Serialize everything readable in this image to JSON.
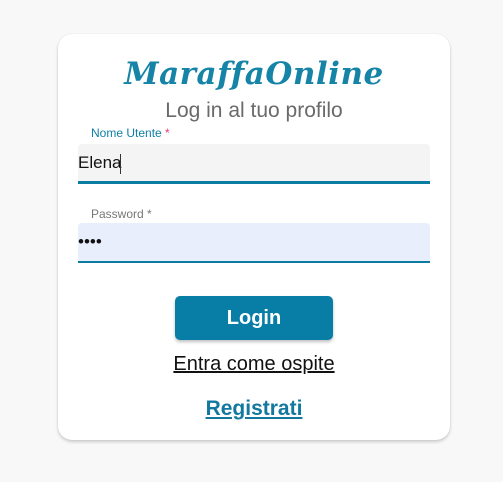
{
  "app": {
    "brand": "MaraffaOnline",
    "subtitle": "Log in al tuo profilo"
  },
  "form": {
    "username": {
      "label": "Nome Utente",
      "required_mark": "*",
      "value": "Elena"
    },
    "password": {
      "label": "Password",
      "required_mark": "*",
      "value": "••••"
    },
    "login_label": "Login",
    "guest_label": "Entra come ospite",
    "register_label": "Registrati"
  },
  "colors": {
    "accent": "#087ea6",
    "brand": "#1584a6",
    "required": "#e0417a",
    "password_bg": "#e8eefc"
  }
}
